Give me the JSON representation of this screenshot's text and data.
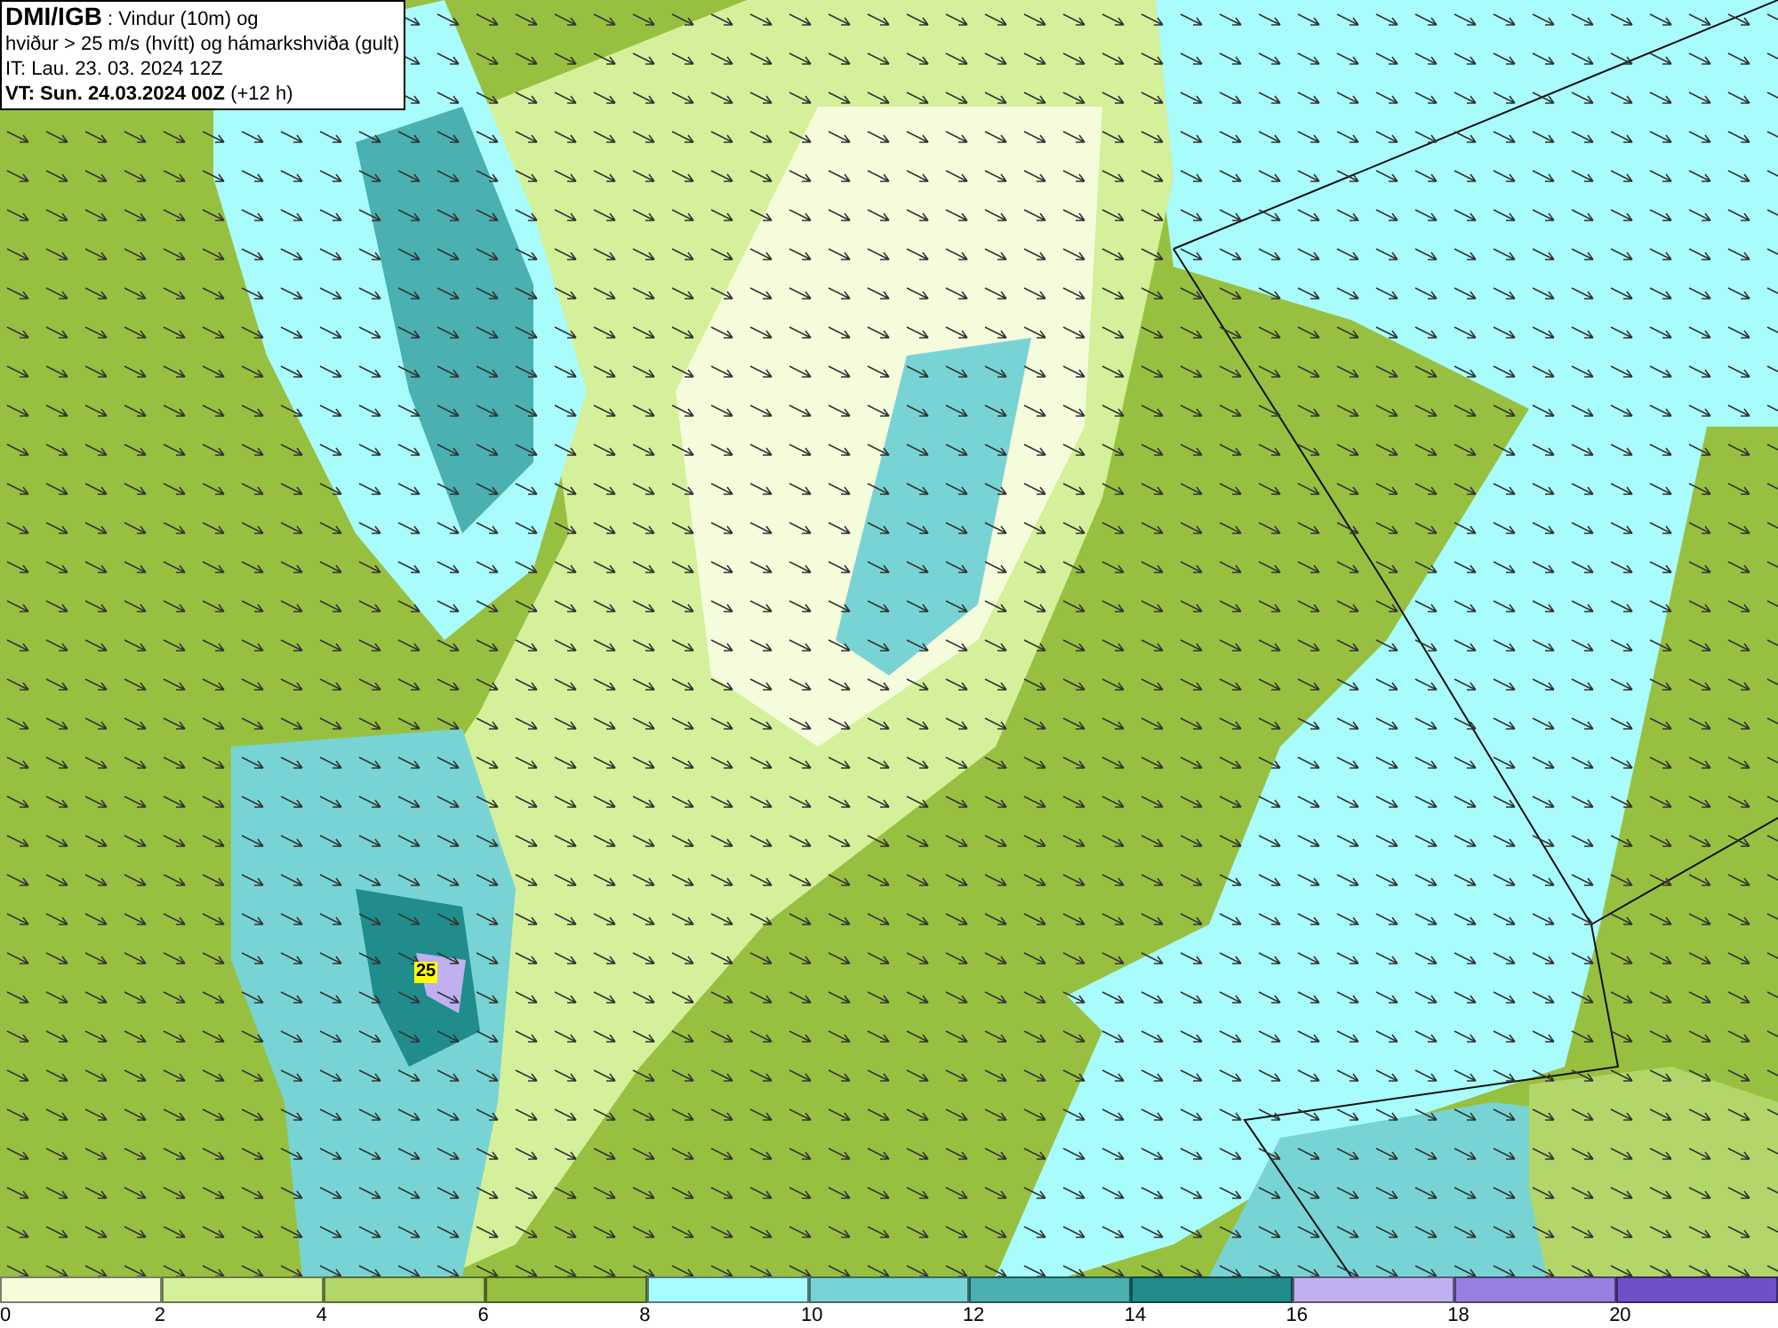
{
  "title_box": {
    "source": "DMI/IGB",
    "line1": ": Vindur (10m) og",
    "line2": "hviður > 25 m/s (hvítt) og hámarkshviða (gult)",
    "issue_time": "IT: Lau. 23. 03. 2024 12Z",
    "valid_time": "VT: Sun. 24.03.2024 00Z",
    "lead_time": "(+12 h)"
  },
  "map": {
    "gust_marker": "25"
  },
  "legend": {
    "items": [
      {
        "color": "#f4fcdc",
        "label": "0"
      },
      {
        "color": "#d4f09a",
        "label": "2"
      },
      {
        "color": "#b2d66a",
        "label": "4"
      },
      {
        "color": "#98c040",
        "label": "6"
      },
      {
        "color": "#a8fcfc",
        "label": "8"
      },
      {
        "color": "#78d4d4",
        "label": "10"
      },
      {
        "color": "#4ab0b0",
        "label": "12"
      },
      {
        "color": "#208c8c",
        "label": "14"
      },
      {
        "color": "#c0b0f0",
        "label": "16"
      },
      {
        "color": "#9880e0",
        "label": "18"
      },
      {
        "color": "#7050c8",
        "label": "20"
      }
    ]
  }
}
